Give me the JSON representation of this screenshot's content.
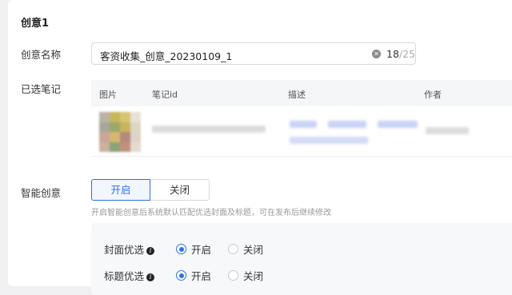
{
  "creative": {
    "title": "创意1",
    "name_label": "创意名称",
    "name_value": "客资收集_创意_20230109_1",
    "name_count": "18",
    "name_max": "/25",
    "clear_icon": "close-circle-icon"
  },
  "notes": {
    "label": "已选笔记",
    "columns": [
      "图片",
      "笔记id",
      "描述",
      "作者"
    ],
    "rows": [
      {
        "image": "blurred-thumbnail",
        "note_id": "",
        "description": "",
        "author": ""
      }
    ]
  },
  "smart": {
    "label": "智能创意",
    "on_label": "开启",
    "off_label": "关闭",
    "selected": "开启",
    "hint": "开启智能创意后系统默认匹配优选封面及标题，可在发布后继续修改",
    "accent": "#2f6fea"
  },
  "options": [
    {
      "label": "封面优选",
      "on": "开启",
      "off": "关闭",
      "selected": "开启",
      "icon": "info-icon"
    },
    {
      "label": "标题优选",
      "on": "开启",
      "off": "关闭",
      "selected": "开启",
      "icon": "info-icon"
    }
  ]
}
